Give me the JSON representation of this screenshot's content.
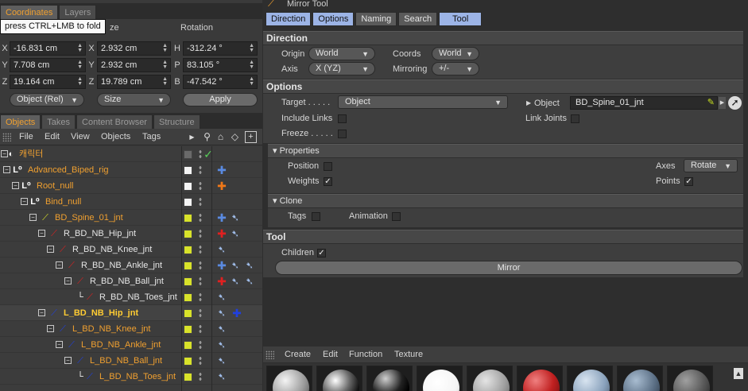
{
  "coords_panel": {
    "tabs": [
      "Coordinates",
      "Layers"
    ],
    "tooltip": "press CTRL+LMB to fold",
    "size_header": "ze",
    "rotation_header": "Rotation",
    "rows": [
      {
        "p_label": "X",
        "p_value": "-16.831 cm",
        "s_label": "X",
        "s_value": "2.932 cm",
        "r_label": "H",
        "r_value": "-312.24 °"
      },
      {
        "p_label": "Y",
        "p_value": "7.708 cm",
        "s_label": "Y",
        "s_value": "2.932 cm",
        "r_label": "P",
        "r_value": "83.105 °"
      },
      {
        "p_label": "Z",
        "p_value": "19.164 cm",
        "s_label": "Z",
        "s_value": "19.789 cm",
        "r_label": "B",
        "r_value": "-47.542 °"
      }
    ],
    "mode_dropdown": "Object (Rel)",
    "size_dropdown": "Size",
    "apply_label": "Apply"
  },
  "objects_panel": {
    "tabs": [
      "Objects",
      "Takes",
      "Content Browser",
      "Structure"
    ],
    "menu": [
      "File",
      "Edit",
      "View",
      "Objects",
      "Tags"
    ],
    "icons": [
      "grip-icon",
      "arrow-right-icon",
      "search-icon",
      "home-icon",
      "eye-icon",
      "new-window-icon"
    ],
    "tree": [
      {
        "name": "캐릭터",
        "color": "orange"
      },
      {
        "name": "Advanced_Biped_rig",
        "color": "orange"
      },
      {
        "name": "Root_null",
        "color": "orange"
      },
      {
        "name": "Bind_null",
        "color": "orange"
      },
      {
        "name": "BD_Spine_01_jnt",
        "color": "orange"
      },
      {
        "name": "R_BD_NB_Hip_jnt",
        "color": "white"
      },
      {
        "name": "R_BD_NB_Knee_jnt",
        "color": "white"
      },
      {
        "name": "R_BD_NB_Ankle_jnt",
        "color": "white"
      },
      {
        "name": "R_BD_NB_Ball_jnt",
        "color": "white"
      },
      {
        "name": "R_BD_NB_Toes_jnt",
        "color": "white"
      },
      {
        "name": "L_BD_NB_Hip_jnt",
        "color": "yellow"
      },
      {
        "name": "L_BD_NB_Knee_jnt",
        "color": "orange"
      },
      {
        "name": "L_BD_NB_Ankle_jnt",
        "color": "orange"
      },
      {
        "name": "L_BD_NB_Ball_jnt",
        "color": "orange"
      },
      {
        "name": "L_BD_NB_Toes_jnt",
        "color": "orange"
      }
    ]
  },
  "tool_panel": {
    "title": "Mirror Tool",
    "tabs": [
      "Direction",
      "Options",
      "Naming",
      "Search",
      "Tool"
    ],
    "direction": {
      "header": "Direction",
      "origin_label": "Origin",
      "origin_value": "World",
      "coords_label": "Coords",
      "coords_value": "World",
      "axis_label": "Axis",
      "axis_value": "X (YZ)",
      "mirroring_label": "Mirroring",
      "mirroring_value": "+/-"
    },
    "options": {
      "header": "Options",
      "target_label": "Target . . . . .",
      "target_value": "Object",
      "object_label": "Object",
      "object_value": "BD_Spine_01_jnt",
      "include_links_label": "Include Links",
      "link_joints_label": "Link Joints",
      "freeze_label": "Freeze . . . . ."
    },
    "properties": {
      "header": "Properties",
      "position_label": "Position",
      "weights_label": "Weights",
      "axes_label": "Axes",
      "axes_value": "Rotate",
      "points_label": "Points"
    },
    "clone": {
      "header": "Clone",
      "tags_label": "Tags",
      "animation_label": "Animation"
    },
    "tool": {
      "header": "Tool",
      "children_label": "Children",
      "mirror_button": "Mirror"
    }
  },
  "material_panel": {
    "menu": [
      "Create",
      "Edit",
      "Function",
      "Texture"
    ]
  }
}
